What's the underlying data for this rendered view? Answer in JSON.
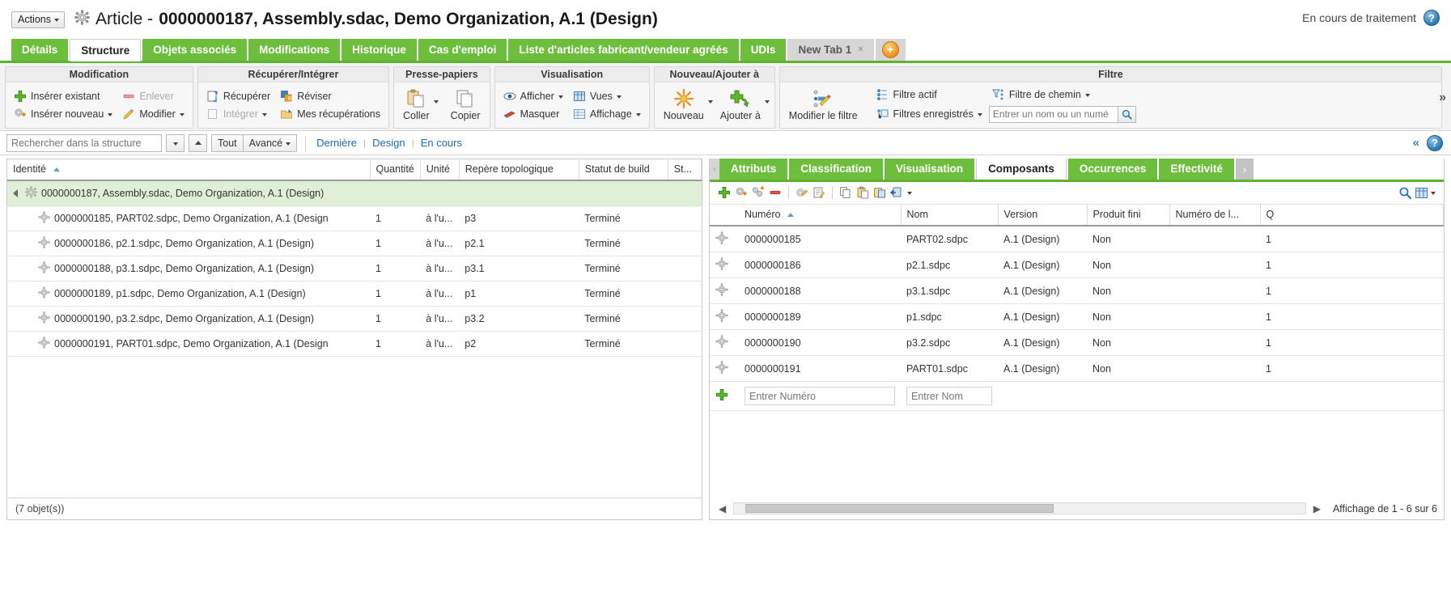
{
  "header": {
    "actions_label": "Actions",
    "title_prefix": "Article -",
    "title_object": "0000000187, Assembly.sdac, Demo Organization, A.1 (Design)",
    "status_text": "En cours de traitement",
    "help_label": "?"
  },
  "tabs": [
    {
      "label": "Détails",
      "state": "green"
    },
    {
      "label": "Structure",
      "state": "active"
    },
    {
      "label": "Objets associés",
      "state": "green"
    },
    {
      "label": "Modifications",
      "state": "green"
    },
    {
      "label": "Historique",
      "state": "green"
    },
    {
      "label": "Cas d'emploi",
      "state": "green"
    },
    {
      "label": "Liste d'articles fabricant/vendeur agréés",
      "state": "green"
    },
    {
      "label": "UDIs",
      "state": "green"
    },
    {
      "label": "New Tab 1",
      "state": "grey",
      "close": "×"
    }
  ],
  "ribbon": {
    "expand_label": "»",
    "groups": [
      {
        "title": "Modification",
        "items": [
          {
            "label": "Insérer existant",
            "icon": "green-plus-icon",
            "disabled": false,
            "dropdown": false
          },
          {
            "label": "Insérer nouveau",
            "icon": "new-part-icon",
            "disabled": false,
            "dropdown": true
          },
          {
            "label": "Enlever",
            "icon": "red-minus-icon",
            "disabled": true,
            "dropdown": false
          },
          {
            "label": "Modifier",
            "icon": "pencil-icon",
            "disabled": false,
            "dropdown": true
          }
        ]
      },
      {
        "title": "Récupérer/Intégrer",
        "items": [
          {
            "label": "Récupérer",
            "icon": "checkout-icon",
            "disabled": false,
            "dropdown": false
          },
          {
            "label": "Intégrer",
            "icon": "checkin-icon",
            "disabled": true,
            "dropdown": true
          },
          {
            "label": "Réviser",
            "icon": "revise-icon",
            "disabled": false,
            "dropdown": false
          },
          {
            "label": "Mes récupérations",
            "icon": "my-checkouts-icon",
            "disabled": false,
            "dropdown": false
          }
        ]
      },
      {
        "title": "Presse-papiers",
        "items": [
          {
            "label": "Coller",
            "icon": "paste-icon",
            "disabled": false,
            "dropdown": true
          },
          {
            "label": "Copier",
            "icon": "copy-icon",
            "disabled": false,
            "dropdown": false
          }
        ]
      },
      {
        "title": "Visualisation",
        "items": [
          {
            "label": "Afficher",
            "icon": "eye-icon",
            "disabled": false,
            "dropdown": true
          },
          {
            "label": "Masquer",
            "icon": "hide-icon",
            "disabled": false,
            "dropdown": false
          },
          {
            "label": "Vues",
            "icon": "views-icon",
            "disabled": false,
            "dropdown": true
          },
          {
            "label": "Affichage",
            "icon": "display-icon",
            "disabled": false,
            "dropdown": true
          }
        ]
      },
      {
        "title": "Nouveau/Ajouter à",
        "items": [
          {
            "label": "Nouveau",
            "icon": "sunburst-new-icon",
            "disabled": false,
            "dropdown": true
          },
          {
            "label": "Ajouter à",
            "icon": "add-to-icon",
            "disabled": false,
            "dropdown": true
          }
        ]
      },
      {
        "title": "Filtre",
        "items": [
          {
            "label": "Modifier le filtre",
            "icon": "edit-filter-icon",
            "disabled": false,
            "dropdown": false
          },
          {
            "label": "Filtre actif",
            "icon": "active-filter-icon",
            "disabled": false,
            "dropdown": false
          },
          {
            "label": "Filtre de chemin",
            "icon": "path-filter-icon",
            "disabled": false,
            "dropdown": true
          },
          {
            "label": "Filtres enregistrés",
            "icon": "saved-filters-icon",
            "disabled": false,
            "dropdown": true
          }
        ],
        "saved_filter_placeholder": "Entrer un nom ou un numé"
      }
    ]
  },
  "searchbar": {
    "search_placeholder": "Rechercher dans la structure",
    "dropdown_icon": "chevron-down-icon",
    "up_icon": "chevron-up-icon",
    "scope_all": "Tout",
    "scope_advanced": "Avancé",
    "links": [
      "Dernière",
      "Design",
      "En cours"
    ],
    "collapse_icon": "double-chevron-up-icon",
    "help_label": "?"
  },
  "left_pane": {
    "columns": [
      "Identité",
      "Quantité",
      "Unité",
      "Repère topologique",
      "Statut de build",
      "St..."
    ],
    "sort_column": "Identité",
    "root": {
      "identite": "0000000187, Assembly.sdac, Demo Organization, A.1 (Design)",
      "quantite": "",
      "unite": "",
      "repere": "",
      "statut_build": "",
      "st": ""
    },
    "rows": [
      {
        "identite": "0000000185, PART02.sdpc, Demo Organization, A.1 (Design",
        "quantite": "1",
        "unite": "à l'u...",
        "repere": "p3",
        "statut_build": "Terminé",
        "st": ""
      },
      {
        "identite": "0000000186, p2.1.sdpc, Demo Organization, A.1 (Design)",
        "quantite": "1",
        "unite": "à l'u...",
        "repere": "p2.1",
        "statut_build": "Terminé",
        "st": ""
      },
      {
        "identite": "0000000188, p3.1.sdpc, Demo Organization, A.1 (Design)",
        "quantite": "1",
        "unite": "à l'u...",
        "repere": "p3.1",
        "statut_build": "Terminé",
        "st": ""
      },
      {
        "identite": "0000000189, p1.sdpc, Demo Organization, A.1 (Design)",
        "quantite": "1",
        "unite": "à l'u...",
        "repere": "p1",
        "statut_build": "Terminé",
        "st": ""
      },
      {
        "identite": "0000000190, p3.2.sdpc, Demo Organization, A.1 (Design)",
        "quantite": "1",
        "unite": "à l'u...",
        "repere": "p3.2",
        "statut_build": "Terminé",
        "st": ""
      },
      {
        "identite": "0000000191, PART01.sdpc, Demo Organization, A.1 (Design",
        "quantite": "1",
        "unite": "à l'u...",
        "repere": "p2",
        "statut_build": "Terminé",
        "st": ""
      }
    ],
    "footer": "(7 objet(s))"
  },
  "right_pane": {
    "tabs": [
      {
        "label": "Attributs",
        "state": "green"
      },
      {
        "label": "Classification",
        "state": "green"
      },
      {
        "label": "Visualisation",
        "state": "green"
      },
      {
        "label": "Composants",
        "state": "active"
      },
      {
        "label": "Occurrences",
        "state": "green"
      },
      {
        "label": "Effectivité",
        "state": "green"
      }
    ],
    "tab_scroll_right": "›",
    "toolbar_icons": [
      "add-icon",
      "new-part-icon",
      "new-multi-icon",
      "remove-icon",
      "edit-part-icon",
      "edit-attributes-icon",
      "copy-icon",
      "paste-icon",
      "paste-special-icon",
      "export-icon"
    ],
    "toolbar_right_icons": [
      "search-icon",
      "table-view-icon"
    ],
    "columns": [
      "Numéro",
      "Nom",
      "Version",
      "Produit fini",
      "Numéro de l...",
      "Q"
    ],
    "sort_column": "Numéro",
    "rows": [
      {
        "numero": "0000000185",
        "nom": "PART02.sdpc",
        "version": "A.1 (Design)",
        "produit_fini": "Non",
        "numero_de_l": "",
        "q": "1"
      },
      {
        "numero": "0000000186",
        "nom": "p2.1.sdpc",
        "version": "A.1 (Design)",
        "produit_fini": "Non",
        "numero_de_l": "",
        "q": "1"
      },
      {
        "numero": "0000000188",
        "nom": "p3.1.sdpc",
        "version": "A.1 (Design)",
        "produit_fini": "Non",
        "numero_de_l": "",
        "q": "1"
      },
      {
        "numero": "0000000189",
        "nom": "p1.sdpc",
        "version": "A.1 (Design)",
        "produit_fini": "Non",
        "numero_de_l": "",
        "q": "1"
      },
      {
        "numero": "0000000190",
        "nom": "p3.2.sdpc",
        "version": "A.1 (Design)",
        "produit_fini": "Non",
        "numero_de_l": "",
        "q": "1"
      },
      {
        "numero": "0000000191",
        "nom": "PART01.sdpc",
        "version": "A.1 (Design)",
        "produit_fini": "Non",
        "numero_de_l": "",
        "q": "1"
      }
    ],
    "add_row": {
      "numero_placeholder": "Entrer Numéro",
      "nom_placeholder": "Entrer Nom"
    },
    "footer_count": "Affichage de 1 - 6 sur 6",
    "scroll_left": "◀",
    "scroll_right": "▶"
  },
  "colors": {
    "green_tab": "#6cbe3c",
    "green_border": "#5fb130",
    "row_selected": "#dff0d6",
    "link_blue": "#1a6bb5"
  }
}
